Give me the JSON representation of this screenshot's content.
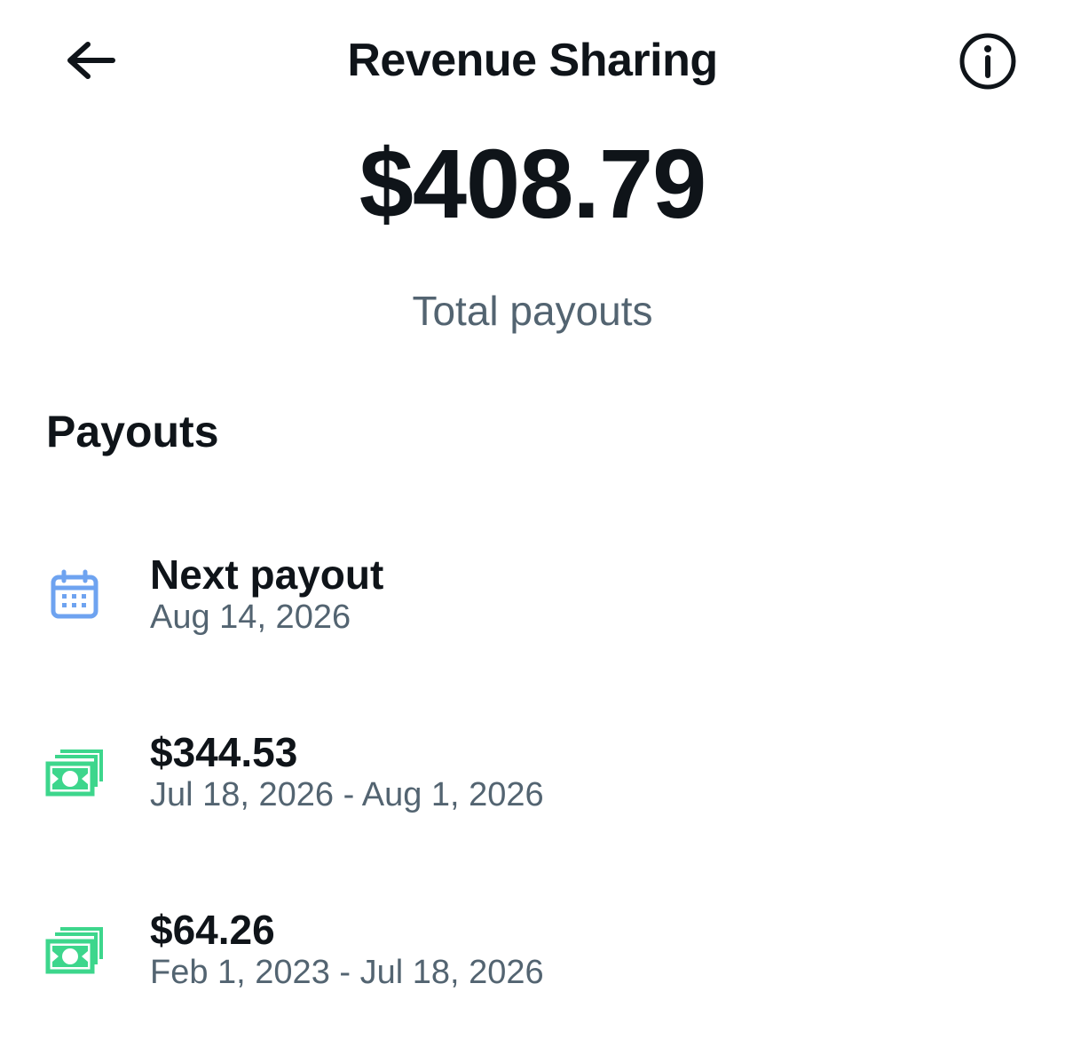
{
  "header": {
    "title": "Revenue Sharing",
    "back_icon": "arrow-left-icon",
    "info_icon": "info-circle-icon"
  },
  "summary": {
    "amount": "$408.79",
    "label": "Total payouts"
  },
  "payouts": {
    "section_title": "Payouts",
    "next": {
      "icon": "calendar-icon",
      "title": "Next payout",
      "date": "Aug 14, 2026"
    },
    "items": [
      {
        "icon": "money-icon",
        "amount": "$344.53",
        "period": "Jul 18, 2026 - Aug 1, 2026"
      },
      {
        "icon": "money-icon",
        "amount": "$64.26",
        "period": "Feb 1, 2023 - Jul 18, 2026"
      }
    ]
  },
  "colors": {
    "text_primary": "#0f1419",
    "text_secondary": "#536471",
    "calendar_icon": "#6ea3f0",
    "money_icon": "#3dd68c"
  }
}
